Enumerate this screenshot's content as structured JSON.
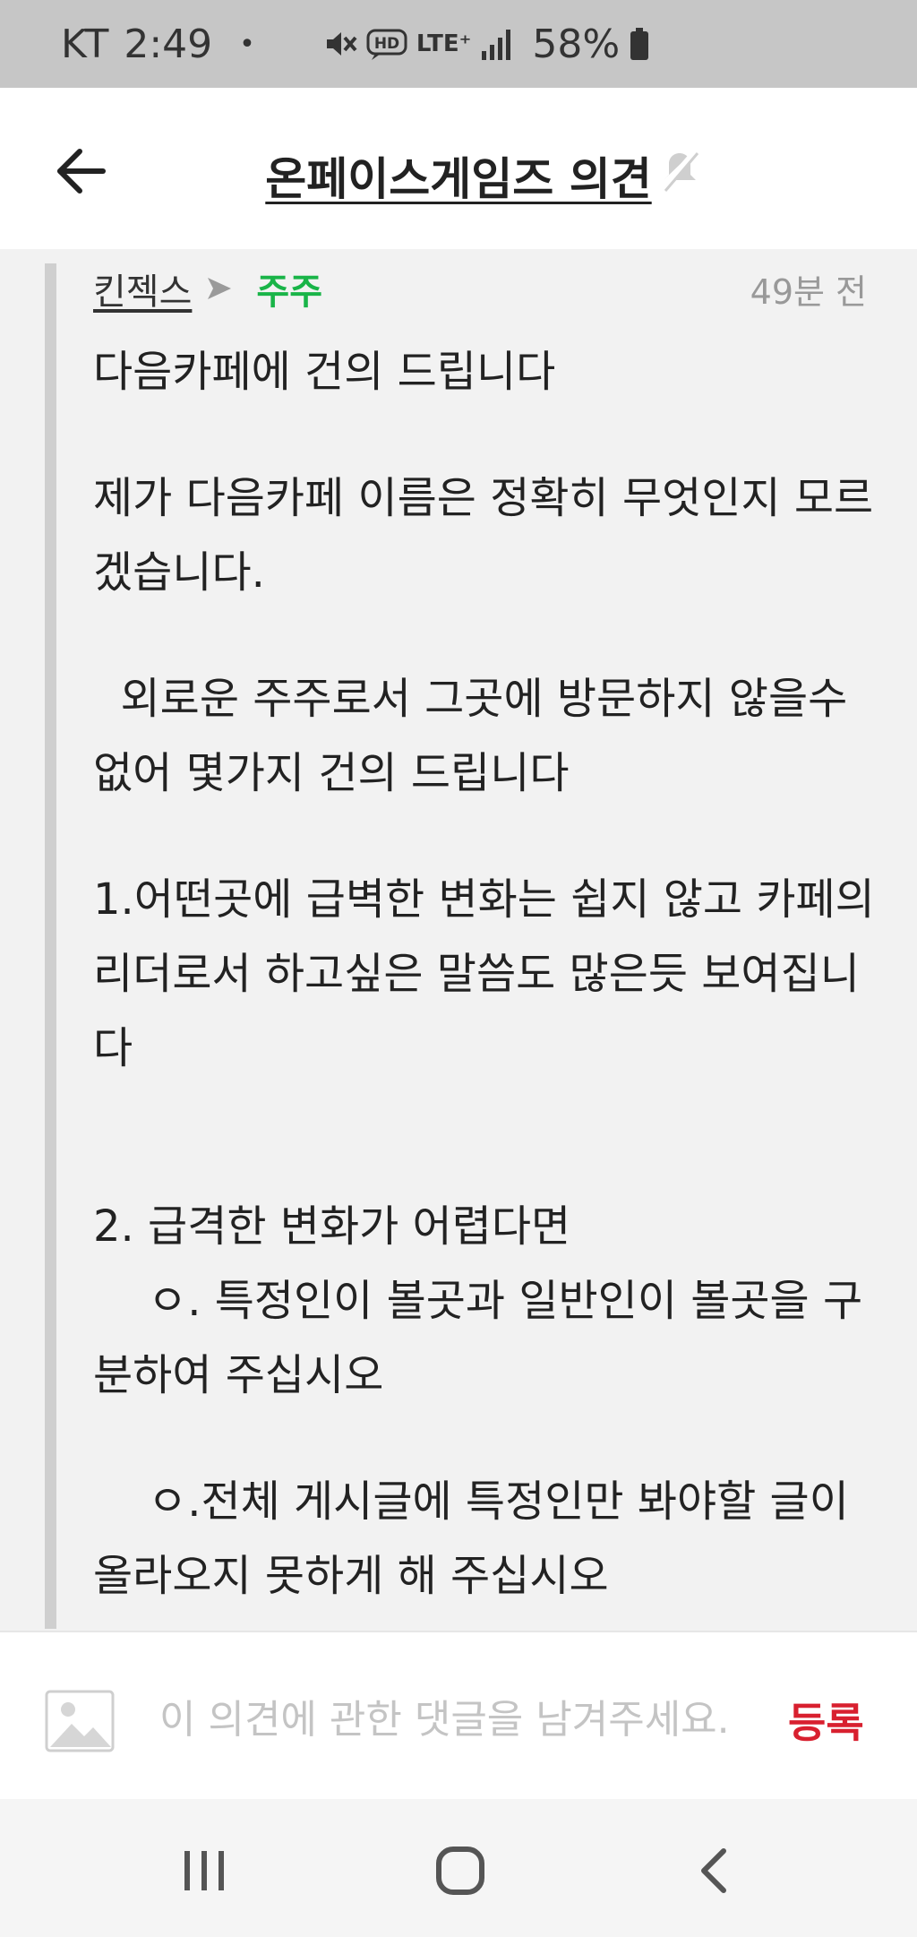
{
  "status_bar": {
    "carrier": "KT",
    "time": "2:49",
    "dot": "•",
    "hd_label": "HD",
    "lte_label": "LTE⁺",
    "battery_percent": "58%",
    "icons": [
      "mute-icon",
      "hd-voice-icon",
      "lte-icon",
      "signal-icon",
      "battery-icon"
    ]
  },
  "header": {
    "title": "온페이스게임즈 의견",
    "back_icon": "arrow-left-icon",
    "notify_icon": "bell-off-icon"
  },
  "post": {
    "author": "킨젝스",
    "arrow_icon": "triangle-right-icon",
    "role": "주주",
    "time_ago": "49분 전",
    "paragraphs": [
      "다음카페에 건의 드립니다",
      "제가 다음카페 이름은 정확히 무엇인지 모르겠습니다.",
      "  외로운 주주로서 그곳에 방문하지 않을수 없어 몇가지 건의 드립니다",
      "1.어떤곳에 급벽한 변화는 쉽지 않고 카페의 리더로서 하고싶은 말씀도 많은듯 보여집니다",
      "2. 급격한 변화가 어렵다면\n    ㅇ. 특정인이 볼곳과 일반인이 볼곳을 구분하여 주십시오",
      "    ㅇ.전체 게시글에 특정인만 봐야할 글이 올라오지 못하게 해 주십시오"
    ],
    "colors": {
      "role": "#19b448",
      "submit": "#d8202f",
      "quote_bar": "#cfcfcf"
    }
  },
  "comment": {
    "image_icon": "image-icon",
    "placeholder": "이 의견에 관한 댓글을 남겨주세요.",
    "value": "",
    "submit_label": "등록"
  },
  "nav": {
    "recents_icon": "recents-icon",
    "home_icon": "home-icon",
    "back_icon": "chevron-left-icon"
  }
}
